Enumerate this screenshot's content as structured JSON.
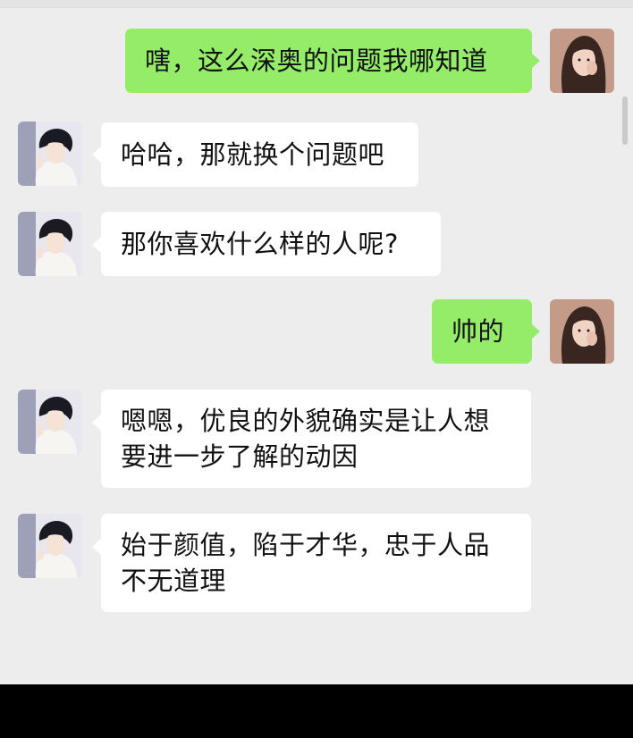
{
  "colors": {
    "chat_background": "#ededed",
    "my_bubble": "#95ec69",
    "their_bubble": "#ffffff"
  },
  "messages": [
    {
      "sender": "me",
      "avatar": "girl-avatar",
      "text": "嗐，这么深奥的问题我哪知道"
    },
    {
      "sender": "them",
      "avatar": "boy-avatar",
      "text": "哈哈，那就换个问题吧"
    },
    {
      "sender": "them",
      "avatar": "boy-avatar",
      "text": "那你喜欢什么样的人呢?"
    },
    {
      "sender": "me",
      "avatar": "girl-avatar",
      "text": "帅的"
    },
    {
      "sender": "them",
      "avatar": "boy-avatar",
      "text": "嗯嗯，优良的外貌确实是让人想\n要进一步了解的动因"
    },
    {
      "sender": "them",
      "avatar": "boy-avatar",
      "text": "始于颜值，陷于才华，忠于人品\n不无道理"
    }
  ]
}
